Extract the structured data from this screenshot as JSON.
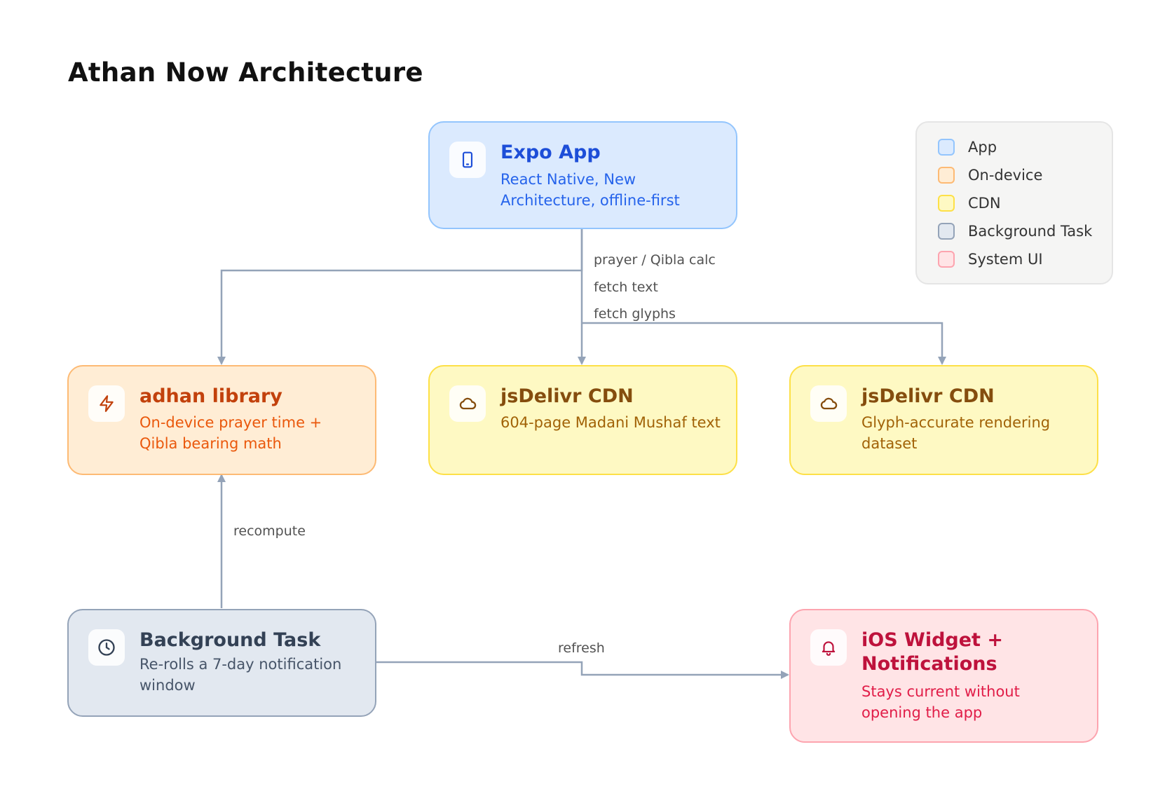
{
  "page": {
    "title": "Athan Now Architecture"
  },
  "nodes": {
    "expo_app": {
      "title": "Expo App",
      "description": "React Native, New Architecture, offline-first",
      "icon": "smartphone-icon"
    },
    "adhan": {
      "title": "adhan library",
      "description": "On-device prayer time + Qibla bearing math",
      "icon": "lightning-icon"
    },
    "cdn_text": {
      "title": "jsDelivr CDN",
      "description": "604-page Madani Mushaf text",
      "icon": "cloud-icon"
    },
    "cdn_glyphs": {
      "title": "jsDelivr CDN",
      "description": "Glyph-accurate rendering dataset",
      "icon": "cloud-icon"
    },
    "background_task": {
      "title": "Background Task",
      "description": "Re-rolls a 7-day notification window",
      "icon": "clock-icon"
    },
    "ios_widget": {
      "title": "iOS Widget + Notifications",
      "description": "Stays current without opening the app",
      "icon": "bell-icon"
    }
  },
  "edges": [
    {
      "from": "expo_app",
      "to": "adhan",
      "label": "prayer / Qibla calc"
    },
    {
      "from": "expo_app",
      "to": "cdn_text",
      "label": "fetch text"
    },
    {
      "from": "expo_app",
      "to": "cdn_glyphs",
      "label": "fetch glyphs"
    },
    {
      "from": "background_task",
      "to": "adhan",
      "label": "recompute"
    },
    {
      "from": "background_task",
      "to": "ios_widget",
      "label": "refresh"
    }
  ],
  "legend": [
    {
      "label": "App",
      "fill": "#dbeafe",
      "stroke": "#93c5fd"
    },
    {
      "label": "On-device",
      "fill": "#ffedd5",
      "stroke": "#fdba74"
    },
    {
      "label": "CDN",
      "fill": "#fef9c3",
      "stroke": "#fde047"
    },
    {
      "label": "Background Task",
      "fill": "#e2e8f0",
      "stroke": "#94a3b8"
    },
    {
      "label": "System UI",
      "fill": "#ffe4e6",
      "stroke": "#fda4af"
    }
  ],
  "colors": {
    "connector": "#94a3b8"
  }
}
